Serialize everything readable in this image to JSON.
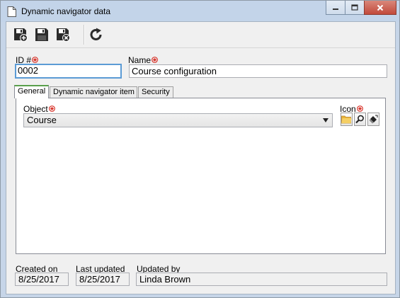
{
  "window": {
    "title": "Dynamic navigator data",
    "icon": "document-icon",
    "controls": [
      "minimize-icon",
      "maximize-icon",
      "close-icon"
    ]
  },
  "toolbar": {
    "buttons": [
      {
        "name": "save-and-new-button",
        "icon": "floppy-plus-icon"
      },
      {
        "name": "save-button",
        "icon": "floppy-icon"
      },
      {
        "name": "save-and-close-button",
        "icon": "floppy-x-icon"
      },
      {
        "name": "refresh-button",
        "icon": "refresh-icon"
      }
    ]
  },
  "form": {
    "id_label": "ID #",
    "id_value": "0002",
    "name_label": "Name",
    "name_value": "Course configuration"
  },
  "tabs": [
    {
      "label": "General",
      "active": true
    },
    {
      "label": "Dynamic navigator item",
      "active": false
    },
    {
      "label": "Security",
      "active": false
    }
  ],
  "general": {
    "object_label": "Object",
    "object_value": "Course",
    "icon_label": "Icon",
    "icon_buttons": [
      "folder-icon",
      "magnifier-icon",
      "eraser-icon"
    ]
  },
  "footer": {
    "created_label": "Created on",
    "created_value": "8/25/2017",
    "updated_label": "Last updated",
    "updated_value": "8/25/2017",
    "updated_by_label": "Updated by",
    "updated_by_value": "Linda Brown"
  },
  "colors": {
    "required": "#d9342b",
    "active_tab_accent": "#5aa04c",
    "focus_border": "#5b9bd5",
    "close_button": "#c24a3b"
  }
}
